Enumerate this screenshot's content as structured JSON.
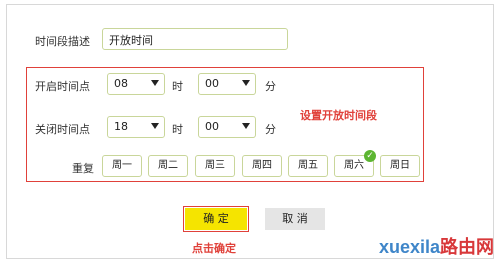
{
  "form": {
    "desc_label": "时间段描述",
    "desc_value": "开放时间",
    "start_label": "开启时间点",
    "start_hour": "08",
    "start_minute": "00",
    "end_label": "关闭时间点",
    "end_hour": "18",
    "end_minute": "00",
    "hour_unit": "时",
    "minute_unit": "分",
    "repeat_label": "重复",
    "days": [
      "周一",
      "周二",
      "周三",
      "周四",
      "周五",
      "周六",
      "周日"
    ],
    "selected_day": "周六"
  },
  "annotations": {
    "set_open_period": "设置开放时间段",
    "click_ok": "点击确定"
  },
  "buttons": {
    "ok": "确 定",
    "cancel": "取 消"
  },
  "watermark": {
    "en": "xuexila",
    "cn": "路由网"
  },
  "colors": {
    "accent_red": "#e0413a",
    "ok_button_bg": "#f5e400",
    "input_border": "#c9d69a",
    "check_green": "#5cb531"
  }
}
